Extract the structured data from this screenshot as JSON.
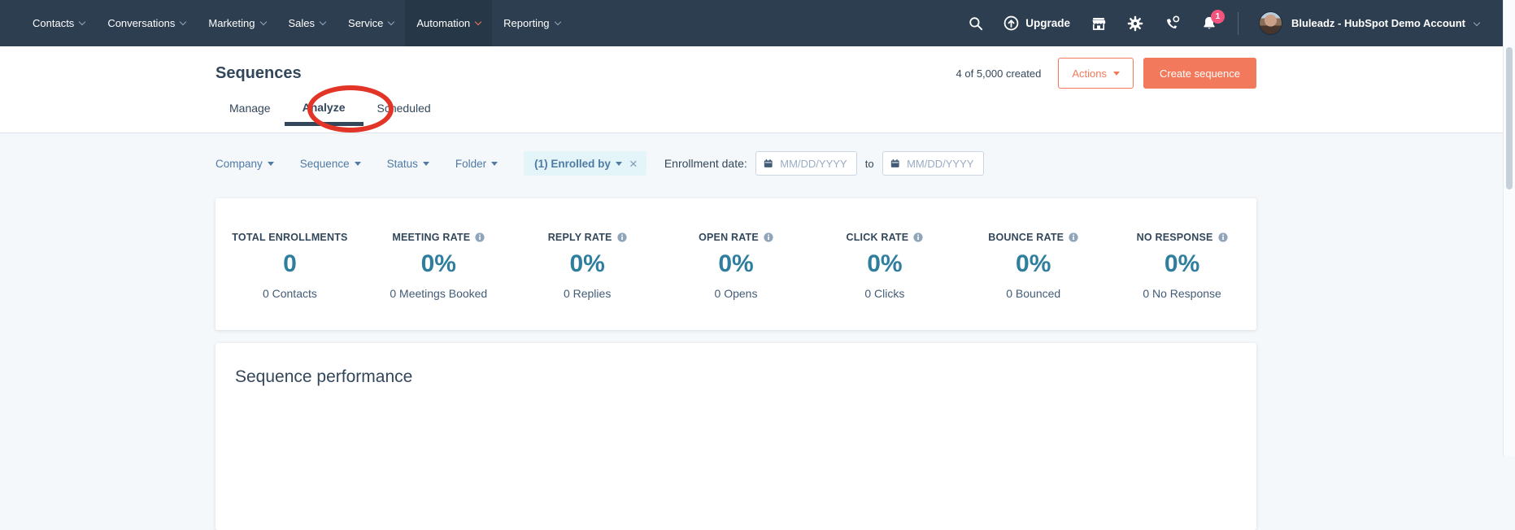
{
  "nav": {
    "items": [
      {
        "label": "Contacts"
      },
      {
        "label": "Conversations"
      },
      {
        "label": "Marketing"
      },
      {
        "label": "Sales"
      },
      {
        "label": "Service"
      },
      {
        "label": "Automation",
        "active": true
      },
      {
        "label": "Reporting"
      }
    ],
    "upgrade_label": "Upgrade",
    "notification_count": "1",
    "account_label": "Bluleadz - HubSpot Demo Account",
    "icons": [
      "search-icon",
      "upgrade-icon",
      "marketplace-icon",
      "settings-icon",
      "calls-icon",
      "notifications-icon"
    ]
  },
  "header": {
    "title": "Sequences",
    "created_count": "4 of 5,000 created",
    "actions_label": "Actions",
    "create_label": "Create sequence"
  },
  "tabs": [
    {
      "label": "Manage"
    },
    {
      "label": "Analyze",
      "active": true,
      "annotated": "red-ellipse"
    },
    {
      "label": "Scheduled"
    }
  ],
  "filters": {
    "dropdowns": [
      {
        "label": "Company"
      },
      {
        "label": "Sequence"
      },
      {
        "label": "Status"
      },
      {
        "label": "Folder"
      }
    ],
    "chip": {
      "label": "(1) Enrolled by",
      "close": "×"
    },
    "enrollment_date_label": "Enrollment date:",
    "date_from_placeholder": "MM/DD/YYYY",
    "to_label": "to",
    "date_to_placeholder": "MM/DD/YYYY"
  },
  "stats": [
    {
      "title": "TOTAL ENROLLMENTS",
      "has_info": false,
      "value": "0",
      "sub": "0 Contacts"
    },
    {
      "title": "MEETING RATE",
      "has_info": true,
      "value": "0%",
      "sub": "0 Meetings Booked"
    },
    {
      "title": "REPLY RATE",
      "has_info": true,
      "value": "0%",
      "sub": "0 Replies"
    },
    {
      "title": "OPEN RATE",
      "has_info": true,
      "value": "0%",
      "sub": "0 Opens"
    },
    {
      "title": "CLICK RATE",
      "has_info": true,
      "value": "0%",
      "sub": "0 Clicks"
    },
    {
      "title": "BOUNCE RATE",
      "has_info": true,
      "value": "0%",
      "sub": "0 Bounced"
    },
    {
      "title": "NO RESPONSE",
      "has_info": true,
      "value": "0%",
      "sub": "0 No Response"
    }
  ],
  "performance": {
    "title": "Sequence performance"
  },
  "colors": {
    "nav_bg": "#2d3e50",
    "accent_orange": "#f2795c",
    "stat_value_teal": "#2f7e9d",
    "filter_link_blue": "#4e7aa5",
    "badge_pink": "#f2547d",
    "page_bg": "#f5f8fa"
  }
}
